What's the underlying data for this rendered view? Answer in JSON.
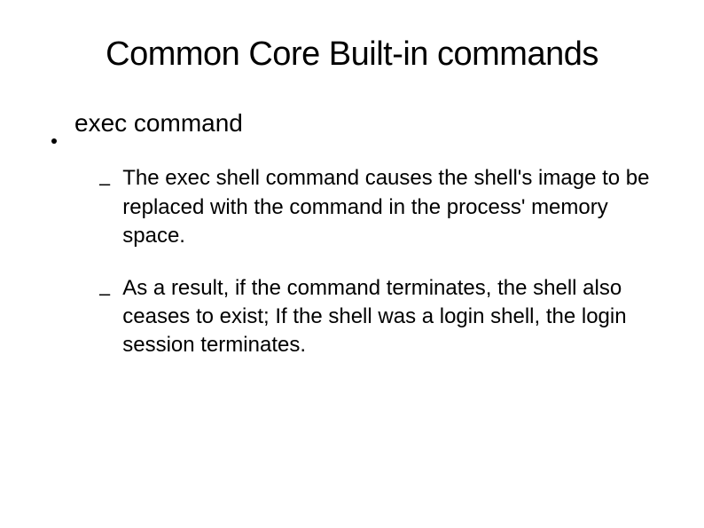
{
  "title": "Common Core Built-in commands",
  "bullets": [
    {
      "text": "exec command",
      "subitems": [
        "The exec shell command causes the shell's image to be replaced with the command in the process' memory space.",
        "As a result, if the command terminates, the shell also ceases to exist; If the shell was a login shell, the login session terminates."
      ]
    }
  ]
}
